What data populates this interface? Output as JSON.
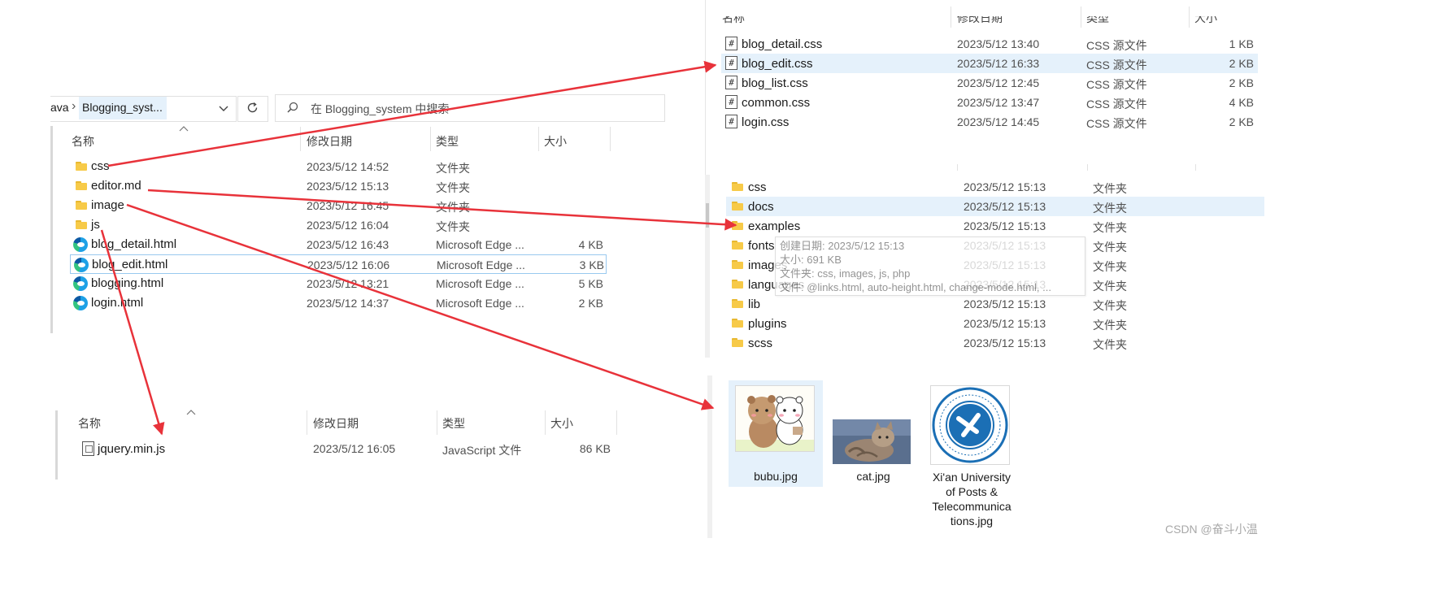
{
  "left_top": {
    "breadcrumb": {
      "partial": "ava",
      "arrow": "›",
      "current": "Blogging_syst..."
    },
    "search_placeholder": "在 Blogging_system 中搜索",
    "headers": {
      "name": "名称",
      "date": "修改日期",
      "type": "类型",
      "size": "大小"
    },
    "rows": [
      {
        "name": "css",
        "date": "2023/5/12 14:52",
        "type": "文件夹",
        "size": "",
        "icon": "folder"
      },
      {
        "name": "editor.md",
        "date": "2023/5/12 15:13",
        "type": "文件夹",
        "size": "",
        "icon": "folder"
      },
      {
        "name": "image",
        "date": "2023/5/12 16:45",
        "type": "文件夹",
        "size": "",
        "icon": "folder"
      },
      {
        "name": "js",
        "date": "2023/5/12 16:04",
        "type": "文件夹",
        "size": "",
        "icon": "folder"
      },
      {
        "name": "blog_detail.html",
        "date": "2023/5/12 16:43",
        "type": "Microsoft Edge ...",
        "size": "4 KB",
        "icon": "edge"
      },
      {
        "name": "blog_edit.html",
        "date": "2023/5/12 16:06",
        "type": "Microsoft Edge ...",
        "size": "3 KB",
        "icon": "edge"
      },
      {
        "name": "blogging.html",
        "date": "2023/5/12 13:21",
        "type": "Microsoft Edge ...",
        "size": "5 KB",
        "icon": "edge"
      },
      {
        "name": "login.html",
        "date": "2023/5/12 14:37",
        "type": "Microsoft Edge ...",
        "size": "2 KB",
        "icon": "edge"
      }
    ]
  },
  "left_bottom": {
    "headers": {
      "name": "名称",
      "date": "修改日期",
      "type": "类型",
      "size": "大小"
    },
    "rows": [
      {
        "name": "jquery.min.js",
        "date": "2023/5/12 16:05",
        "type": "JavaScript 文件",
        "size": "86 KB",
        "icon": "js"
      }
    ]
  },
  "right_css": {
    "headers": {
      "name": "名称",
      "date": "修改日期",
      "type": "类型",
      "size": "大小"
    },
    "rows": [
      {
        "name": "blog_detail.css",
        "date": "2023/5/12 13:40",
        "type": "CSS 源文件",
        "size": "1 KB"
      },
      {
        "name": "blog_edit.css",
        "date": "2023/5/12 16:33",
        "type": "CSS 源文件",
        "size": "2 KB"
      },
      {
        "name": "blog_list.css",
        "date": "2023/5/12 12:45",
        "type": "CSS 源文件",
        "size": "2 KB"
      },
      {
        "name": "common.css",
        "date": "2023/5/12 13:47",
        "type": "CSS 源文件",
        "size": "4 KB"
      },
      {
        "name": "login.css",
        "date": "2023/5/12 14:45",
        "type": "CSS 源文件",
        "size": "2 KB"
      }
    ]
  },
  "right_editor": {
    "rows": [
      {
        "name": "css",
        "date": "2023/5/12 15:13",
        "type": "文件夹"
      },
      {
        "name": "docs",
        "date": "2023/5/12 15:13",
        "type": "文件夹"
      },
      {
        "name": "examples",
        "date": "2023/5/12 15:13",
        "type": "文件夹"
      },
      {
        "name": "fonts",
        "date": "2023/5/12 15:13",
        "type": "文件夹"
      },
      {
        "name": "images",
        "date": "2023/5/12 15:13",
        "type": "文件夹"
      },
      {
        "name": "languages",
        "date": "2023/5/12 15:13",
        "type": "文件夹"
      },
      {
        "name": "lib",
        "date": "2023/5/12 15:13",
        "type": "文件夹"
      },
      {
        "name": "plugins",
        "date": "2023/5/12 15:13",
        "type": "文件夹"
      },
      {
        "name": "scss",
        "date": "2023/5/12 15:13",
        "type": "文件夹"
      }
    ],
    "tooltip": {
      "line1": "创建日期: 2023/5/12 15:13",
      "line2": "大小: 691 KB",
      "line3": "文件夹: css, images, js, php",
      "line4": "文件: @links.html, auto-height.html, change-mode.html, ..."
    }
  },
  "right_images": {
    "items": [
      {
        "name": "bubu.jpg"
      },
      {
        "name": "cat.jpg"
      },
      {
        "name": "Xi'an University of Posts & Telecommunications.jpg",
        "label_lines": [
          "Xi'an University",
          "of Posts &",
          "Telecommunica",
          "tions.jpg"
        ]
      }
    ]
  },
  "watermark": "CSDN @奋斗小温",
  "colors": {
    "arrow": "#e8323a",
    "selection": "#e5f1fb",
    "selection_border": "#99c9ef"
  }
}
